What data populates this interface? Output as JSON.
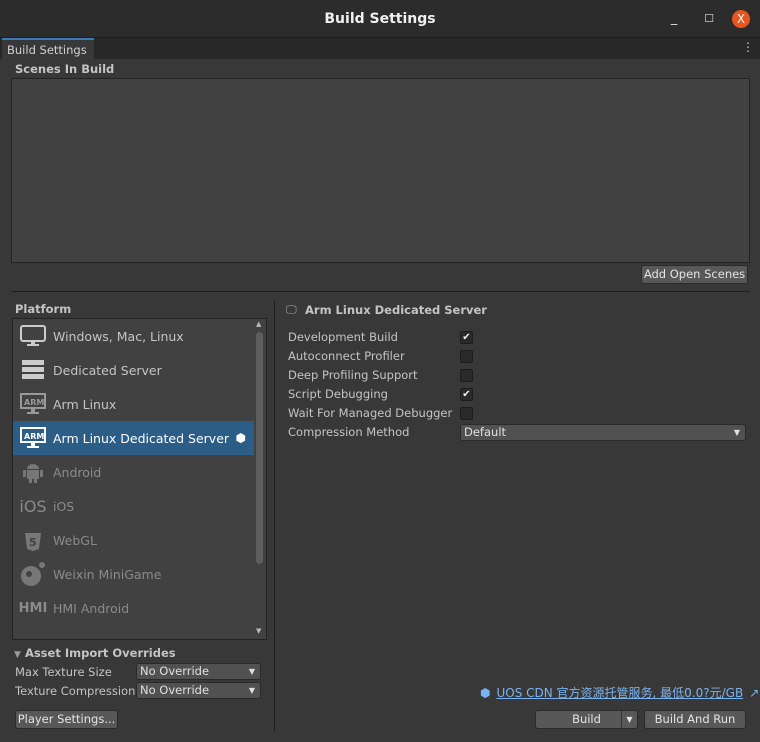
{
  "window": {
    "title": "Build Settings",
    "minimize": "_",
    "maximize": "☐",
    "close": "X"
  },
  "tab": {
    "label": "Build Settings",
    "menu": "⋮"
  },
  "scenes": {
    "label": "Scenes In Build",
    "add_button": "Add Open Scenes"
  },
  "platform": {
    "label": "Platform",
    "items": [
      {
        "label": "Windows, Mac, Linux",
        "icon": "monitor-icon"
      },
      {
        "label": "Dedicated Server",
        "icon": "server-icon"
      },
      {
        "label": "Arm Linux",
        "icon": "arm-icon"
      },
      {
        "label": "Arm Linux Dedicated Server",
        "icon": "arm-icon",
        "selected": true
      },
      {
        "label": "Android",
        "icon": "android-icon"
      },
      {
        "label": "iOS",
        "icon": "ios-icon"
      },
      {
        "label": "WebGL",
        "icon": "html5-icon"
      },
      {
        "label": "Weixin MiniGame",
        "icon": "weixin-icon"
      },
      {
        "label": "HMI Android",
        "icon": "hmi-icon"
      }
    ]
  },
  "settings": {
    "title": "Arm Linux Dedicated Server",
    "rows": [
      {
        "label": "Development Build",
        "checked": true
      },
      {
        "label": "Autoconnect Profiler",
        "checked": false
      },
      {
        "label": "Deep Profiling Support",
        "checked": false
      },
      {
        "label": "Script Debugging",
        "checked": true
      },
      {
        "label": "Wait For Managed Debugger",
        "checked": false
      }
    ],
    "compression": {
      "label": "Compression Method",
      "value": "Default"
    }
  },
  "asset_overrides": {
    "label": "Asset Import Overrides",
    "max_texture": {
      "label": "Max Texture Size",
      "value": "No Override"
    },
    "texture_compression": {
      "label": "Texture Compression",
      "value": "No Override"
    }
  },
  "player_settings": "Player Settings...",
  "uos_link": "UOS CDN 官方资源托管服务, 最低0.0?元/GB",
  "build": "Build",
  "build_and_run": "Build And Run"
}
